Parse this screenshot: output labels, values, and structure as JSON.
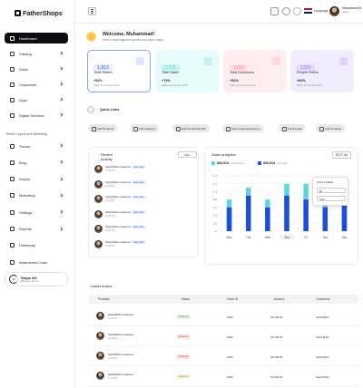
{
  "brand": {
    "name": "FatherShops"
  },
  "sidebar": {
    "items": [
      {
        "label": "Dashboard",
        "active": true,
        "chevron": false
      },
      {
        "label": "Catalog",
        "chevron": true
      },
      {
        "label": "Sales",
        "chevron": true
      },
      {
        "label": "Customers",
        "chevron": true
      },
      {
        "label": "Apps",
        "chevron": true
      },
      {
        "label": "Digital Services",
        "chevron": true
      }
    ],
    "section_label": "Theme Layout and Marketing",
    "theme_items": [
      {
        "label": "Theme",
        "chevron": true
      },
      {
        "label": "Blog",
        "chevron": true
      },
      {
        "label": "Inquiry",
        "chevron": true
      },
      {
        "label": "Marketing",
        "chevron": true
      },
      {
        "label": "Settings",
        "chevron": true
      },
      {
        "label": "Reports",
        "chevron": true
      },
      {
        "label": "Fatherpay",
        "chevron": false
      },
      {
        "label": "Abandoned Carts",
        "chevron": false
      }
    ],
    "steps": {
      "ring": "3/6",
      "title": "Steps 3/6",
      "subtitle": "Add your domain"
    }
  },
  "topbar": {
    "language": "Language",
    "user": {
      "name": "Muhammad Ali",
      "role": "Admin"
    },
    "icons": [
      "menu-icon",
      "bell-icon",
      "gear-icon",
      "moon-icon"
    ]
  },
  "welcome": {
    "title": "Welcome, Muhammad!",
    "subtitle": "Here's what happening with your store today."
  },
  "stats": [
    {
      "value": "1,812",
      "label": "Total Orders",
      "pct": "+52%",
      "note": "Higher from the last month",
      "bg": "#ffffff",
      "border": "#8da2f5",
      "val_bg": "#e8edff",
      "val_color": "#2463eb",
      "badge": "#dfe5ff"
    },
    {
      "value": "230K",
      "label": "Total Sales",
      "pct": "+74%",
      "note": "Higher from the last month",
      "bg": "#e8fbfb",
      "border": "#e8fbfb",
      "val_bg": "#c9f3f3",
      "val_color": "#7ad3d3",
      "badge": "#c6f1f1"
    },
    {
      "value": "1200",
      "label": "Total Customers",
      "pct": "+52%",
      "note": "Higher from the last month",
      "bg": "#ffeef0",
      "border": "#ffeef0",
      "val_bg": "#ffdde1",
      "val_color": "#f0909a",
      "badge": "#ffd6db"
    },
    {
      "value": "1300",
      "label": "People Online",
      "pct": "+66%",
      "note": "Higher from the last month",
      "bg": "#f2ecff",
      "border": "#f2ecff",
      "val_bg": "#e4daff",
      "val_color": "#9b85e6",
      "badge": "#dfd3ff"
    }
  ],
  "quick_links": {
    "title": "Quick Links",
    "chips": [
      "Add Products",
      "Add Category",
      "Add Product Bundle",
      "Add Coupons/Vouchers",
      "Send Email",
      "Add Products"
    ]
  },
  "activity": {
    "title_line1": "Recent",
    "title_line2": "Activity",
    "filter": "Filter",
    "items": [
      {
        "text": "Swati Bishi created a",
        "badge": "New order",
        "meta": "12:40 PM"
      },
      {
        "text": "Swati Bishi created a",
        "badge": "New order",
        "meta": "12:40 PM"
      },
      {
        "text": "Swati Bishi created a",
        "badge": "New order",
        "meta": "12:40 PM"
      },
      {
        "text": "Swati Bishi created a",
        "badge": "New order",
        "meta": "12:40 PM"
      },
      {
        "text": "Swati Bishi created a",
        "badge": "New order",
        "meta": "12:40 PM"
      },
      {
        "text": "Swati Bishi created a",
        "badge": "New order",
        "meta": "12:40 PM"
      }
    ]
  },
  "analytics": {
    "title": "Sales analytics",
    "period": "01-07 Jul",
    "legend": [
      {
        "value": "$68,524",
        "note": "Current week",
        "color": "#5cd5dc"
      },
      {
        "value": "$58,524",
        "note": "Last week",
        "color": "#1d4ed8"
      }
    ],
    "tooltip": {
      "date": "01-07 Jul Wed",
      "row1": "9k",
      "row2": "4.5h"
    }
  },
  "chart_data": {
    "type": "bar",
    "categories": [
      "Mon",
      "Tue",
      "Wed",
      "Thu",
      "Fri",
      "Sat",
      "Sun"
    ],
    "ylim": [
      0,
      1.4
    ],
    "yticks": [
      "0",
      "0.2",
      "0.4",
      "0.6",
      "0.8",
      "1.0",
      "1.2",
      "1.4"
    ],
    "series": [
      {
        "name": "Current week",
        "values": [
          0.8,
          1.1,
          0.8,
          1.2,
          1.2,
          0.8,
          1.1
        ],
        "color": "#5cd5dc"
      },
      {
        "name": "Last week",
        "values": [
          0.6,
          0.9,
          0.6,
          0.9,
          0.8,
          0.6,
          0.8
        ],
        "color": "#1d4ed8"
      }
    ]
  },
  "orders": {
    "title": "Latest orders",
    "columns": [
      "Products",
      "Status",
      "Order ID",
      "Amount",
      "Customers"
    ],
    "rows": [
      {
        "product": "Swati Bishi created a",
        "meta": "12:40 PM",
        "status": "Delivered",
        "status_class": "st-green",
        "order_id": "#266",
        "amount": "39,529.00",
        "customer": "Swati Bishi"
      },
      {
        "product": "Swati Bishi created a",
        "meta": "12:40 PM",
        "status": "Delivered",
        "status_class": "st-red",
        "order_id": "#266",
        "amount": "39,529.00",
        "customer": "Swati Bishi"
      },
      {
        "product": "Swati Bishi created a",
        "meta": "12:40 PM",
        "status": "Delivered",
        "status_class": "st-red",
        "order_id": "#266",
        "amount": "39,529.00",
        "customer": "Swati Bishi"
      },
      {
        "product": "Swati Bishi created a",
        "meta": "12:40 PM",
        "status": "Delivered",
        "status_class": "st-amber",
        "order_id": "#266",
        "amount": "39,529.00",
        "customer": "Swati Bishi"
      }
    ]
  }
}
